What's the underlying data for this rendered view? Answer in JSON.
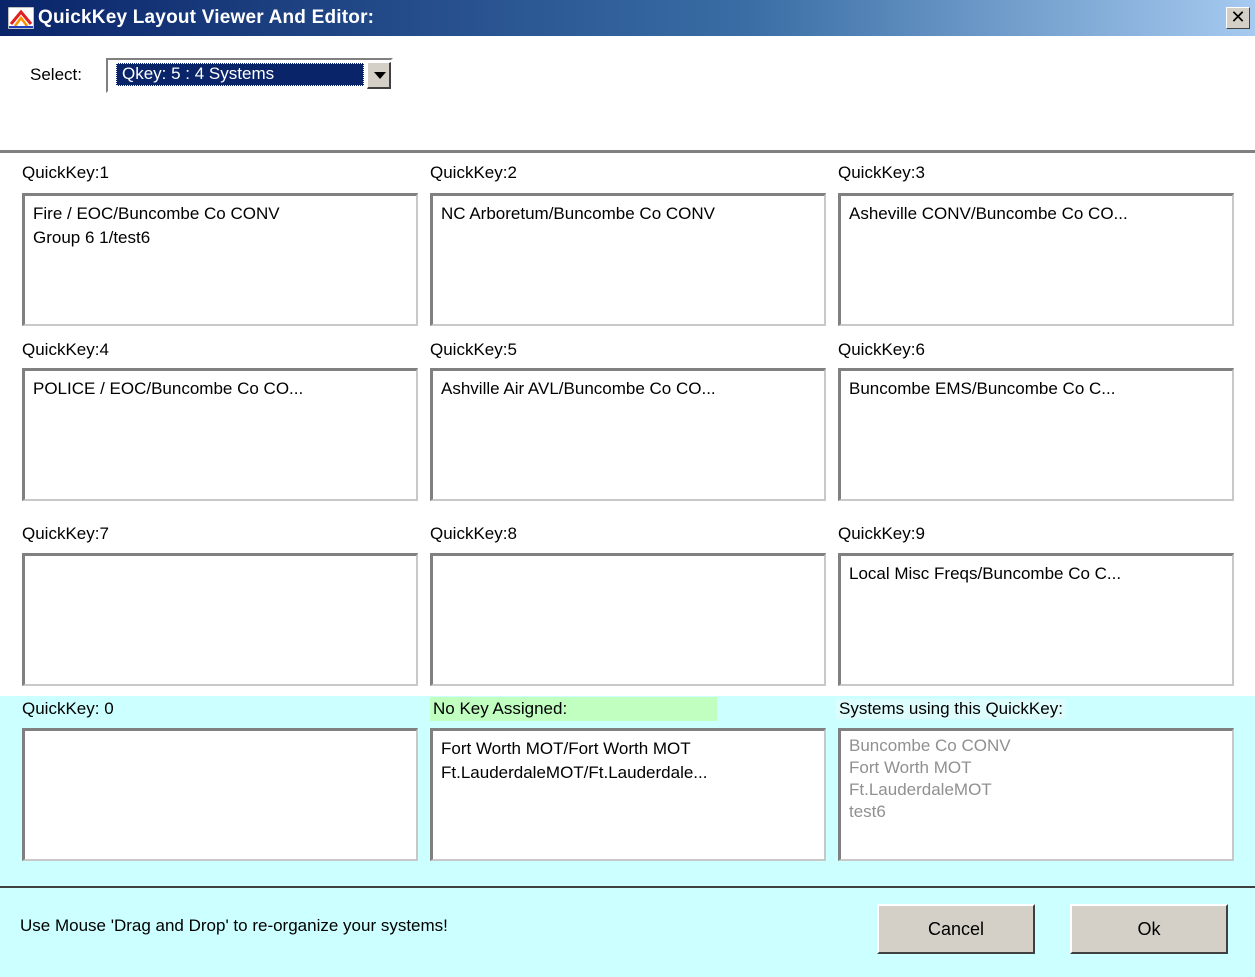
{
  "window": {
    "title": "QuickKey Layout Viewer And Editor:",
    "close_glyph": "✕"
  },
  "select": {
    "label": "Select:",
    "value": "Qkey: 5   : 4 Systems"
  },
  "quickkeys": [
    {
      "label": "QuickKey:1",
      "lines": [
        "Fire / EOC/Buncombe Co CONV",
        "Group 6 1/test6"
      ]
    },
    {
      "label": "QuickKey:2",
      "lines": [
        "NC Arboretum/Buncombe Co CONV"
      ]
    },
    {
      "label": "QuickKey:3",
      "lines": [
        "Asheville CONV/Buncombe Co CO..."
      ]
    },
    {
      "label": "QuickKey:4",
      "lines": [
        "POLICE / EOC/Buncombe Co CO..."
      ]
    },
    {
      "label": "QuickKey:5",
      "lines": [
        "Ashville Air AVL/Buncombe Co CO..."
      ]
    },
    {
      "label": "QuickKey:6",
      "lines": [
        "Buncombe EMS/Buncombe Co C..."
      ]
    },
    {
      "label": "QuickKey:7",
      "lines": []
    },
    {
      "label": "QuickKey:8",
      "lines": []
    },
    {
      "label": "QuickKey:9",
      "lines": [
        "Local Misc Freqs/Buncombe Co C..."
      ]
    },
    {
      "label": "QuickKey: 0",
      "lines": []
    }
  ],
  "no_key": {
    "label": "No Key Assigned:",
    "lines": [
      "Fort Worth MOT/Fort Worth MOT",
      "Ft.LauderdaleMOT/Ft.Lauderdale..."
    ]
  },
  "systems": {
    "label": "Systems using this QuickKey:",
    "lines": [
      "Buncombe Co CONV",
      "Fort Worth MOT",
      "Ft.LauderdaleMOT",
      "test6"
    ]
  },
  "footer": {
    "hint": "Use Mouse 'Drag and Drop' to re-organize your systems!",
    "cancel_label": "Cancel",
    "ok_label": "Ok"
  },
  "colors": {
    "titlebar_start": "#0a246a",
    "titlebar_end": "#a6caf0",
    "no_key_bg": "#c0ffc0",
    "bottom_bg": "#ccffff"
  }
}
